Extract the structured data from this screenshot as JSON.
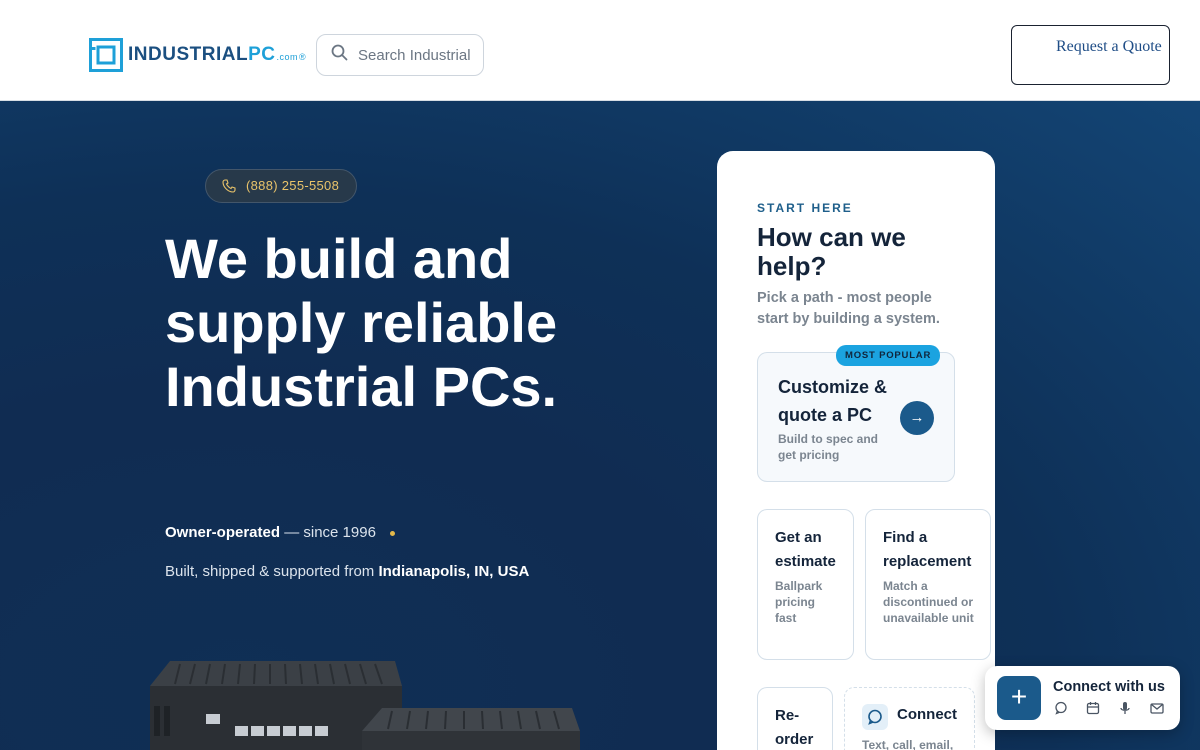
{
  "header": {
    "logo": {
      "main": "INDUSTRIAL",
      "accent": "PC",
      "tld": ".com",
      "reg": "®"
    },
    "search": {
      "placeholder": "Search Industrial"
    },
    "quote_button": "Request a Quote"
  },
  "hero": {
    "phone": "(888) 255-5508",
    "headline": "We build and supply reliable Industrial PCs.",
    "owner_bold": "Owner-operated",
    "owner_rest": " — since 1996",
    "built_prefix": "Built, shipped & supported from ",
    "built_location": "Indianapolis, IN, USA"
  },
  "card": {
    "eyebrow": "START HERE",
    "title": "How can we help?",
    "subtitle": "Pick a path - most people start by building a system.",
    "primary": {
      "badge": "MOST POPULAR",
      "title": "Customize & quote a PC",
      "description": "Build to spec and get pricing",
      "arrow": "→"
    },
    "options": [
      {
        "title": "Get an estimate",
        "description": "Ballpark pricing fast"
      },
      {
        "title": "Find a replacement",
        "description": "Match a discontinued or unavailable unit"
      },
      {
        "title": "Re-order",
        "description": ""
      },
      {
        "title": "Connect",
        "description": "Text, call, email,"
      }
    ]
  },
  "widget": {
    "plus": "+",
    "title": "Connect with us",
    "icons": [
      "chat-icon",
      "calendar-icon",
      "microphone-icon",
      "mail-icon"
    ]
  },
  "colors": {
    "brand_dark": "#1b4f80",
    "brand_light": "#1ea0d8",
    "accent_gold": "#e3b84a",
    "hero_bg": "#0f2f55"
  }
}
